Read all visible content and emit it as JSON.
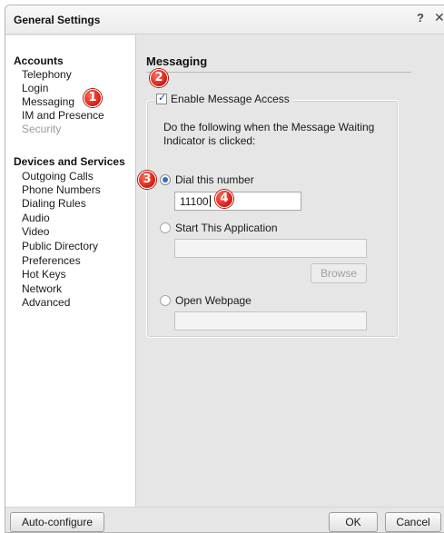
{
  "window": {
    "title": "General Settings",
    "help_glyph": "?",
    "close_glyph": "✕"
  },
  "sidebar": {
    "accounts_heading": "Accounts",
    "accounts_items": [
      {
        "label": "Telephony",
        "disabled": false
      },
      {
        "label": "Login",
        "disabled": false
      },
      {
        "label": "Messaging",
        "disabled": false
      },
      {
        "label": "IM and Presence",
        "disabled": false
      },
      {
        "label": "Security",
        "disabled": true
      }
    ],
    "devices_heading": "Devices and Services",
    "devices_items": [
      {
        "label": "Outgoing Calls"
      },
      {
        "label": "Phone Numbers"
      },
      {
        "label": "Dialing Rules"
      },
      {
        "label": "Audio"
      },
      {
        "label": "Video"
      },
      {
        "label": "Public Directory"
      },
      {
        "label": "Preferences"
      },
      {
        "label": "Hot Keys"
      },
      {
        "label": "Network"
      },
      {
        "label": "Advanced"
      }
    ]
  },
  "messaging": {
    "title": "Messaging",
    "enable_label": "Enable Message Access",
    "enable_checked": true,
    "description": "Do the following when the Message Waiting Indicator is clicked:",
    "dial_label": "Dial this number",
    "dial_selected": true,
    "dial_value": "11100",
    "app_label": "Start This Application",
    "app_value": "",
    "browse_label": "Browse",
    "web_label": "Open Webpage",
    "web_value": ""
  },
  "footer": {
    "autoconfig_label": "Auto-configure",
    "ok_label": "OK",
    "cancel_label": "Cancel"
  },
  "callouts": [
    "1",
    "2",
    "3",
    "4"
  ],
  "colors": {
    "callout": "#d71a10",
    "radio_selected": "#2d6fd1"
  }
}
